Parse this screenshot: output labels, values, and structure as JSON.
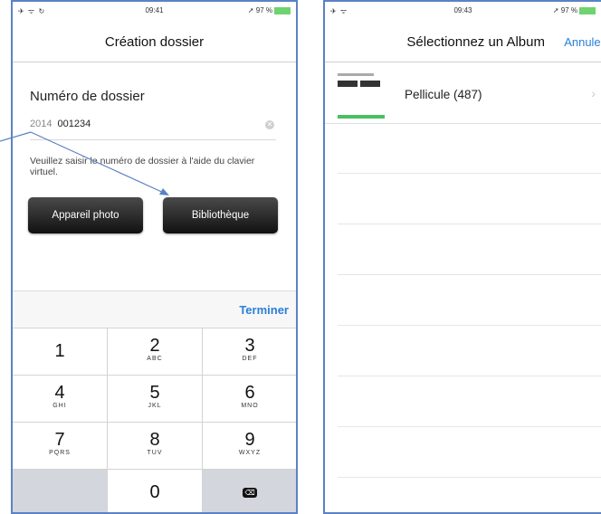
{
  "phone1": {
    "status": {
      "left_icons": "✈ ᯤ ↻",
      "time": "09:41",
      "right": "➚ 97 %"
    },
    "title": "Création dossier",
    "dossier_label": "Numéro de dossier",
    "input": {
      "year": "2014",
      "value": "001234"
    },
    "help_text": "Veuillez saisir le numéro de dossier à l'aide du clavier virtuel.",
    "buttons": {
      "camera": "Appareil photo",
      "library": "Bibliothèque"
    },
    "done": "Terminer",
    "keys": [
      {
        "num": "1",
        "letters": ""
      },
      {
        "num": "2",
        "letters": "ABC"
      },
      {
        "num": "3",
        "letters": "DEF"
      },
      {
        "num": "4",
        "letters": "GHI"
      },
      {
        "num": "5",
        "letters": "JKL"
      },
      {
        "num": "6",
        "letters": "MNO"
      },
      {
        "num": "7",
        "letters": "PQRS"
      },
      {
        "num": "8",
        "letters": "TUV"
      },
      {
        "num": "9",
        "letters": "WXYZ"
      },
      {
        "num": "",
        "letters": ""
      },
      {
        "num": "0",
        "letters": ""
      },
      {
        "num": "⌫",
        "letters": ""
      }
    ]
  },
  "phone2": {
    "status": {
      "left_icons": "✈ ᯤ",
      "time": "09:43",
      "right": "➚ 97 %"
    },
    "title": "Sélectionnez un Album",
    "cancel": "Annuler",
    "album": "Pellicule (487)",
    "chevron": "›"
  },
  "colors": {
    "accent": "#2a7fd7",
    "frame": "#5b82c4",
    "battery": "#6fd36f"
  }
}
